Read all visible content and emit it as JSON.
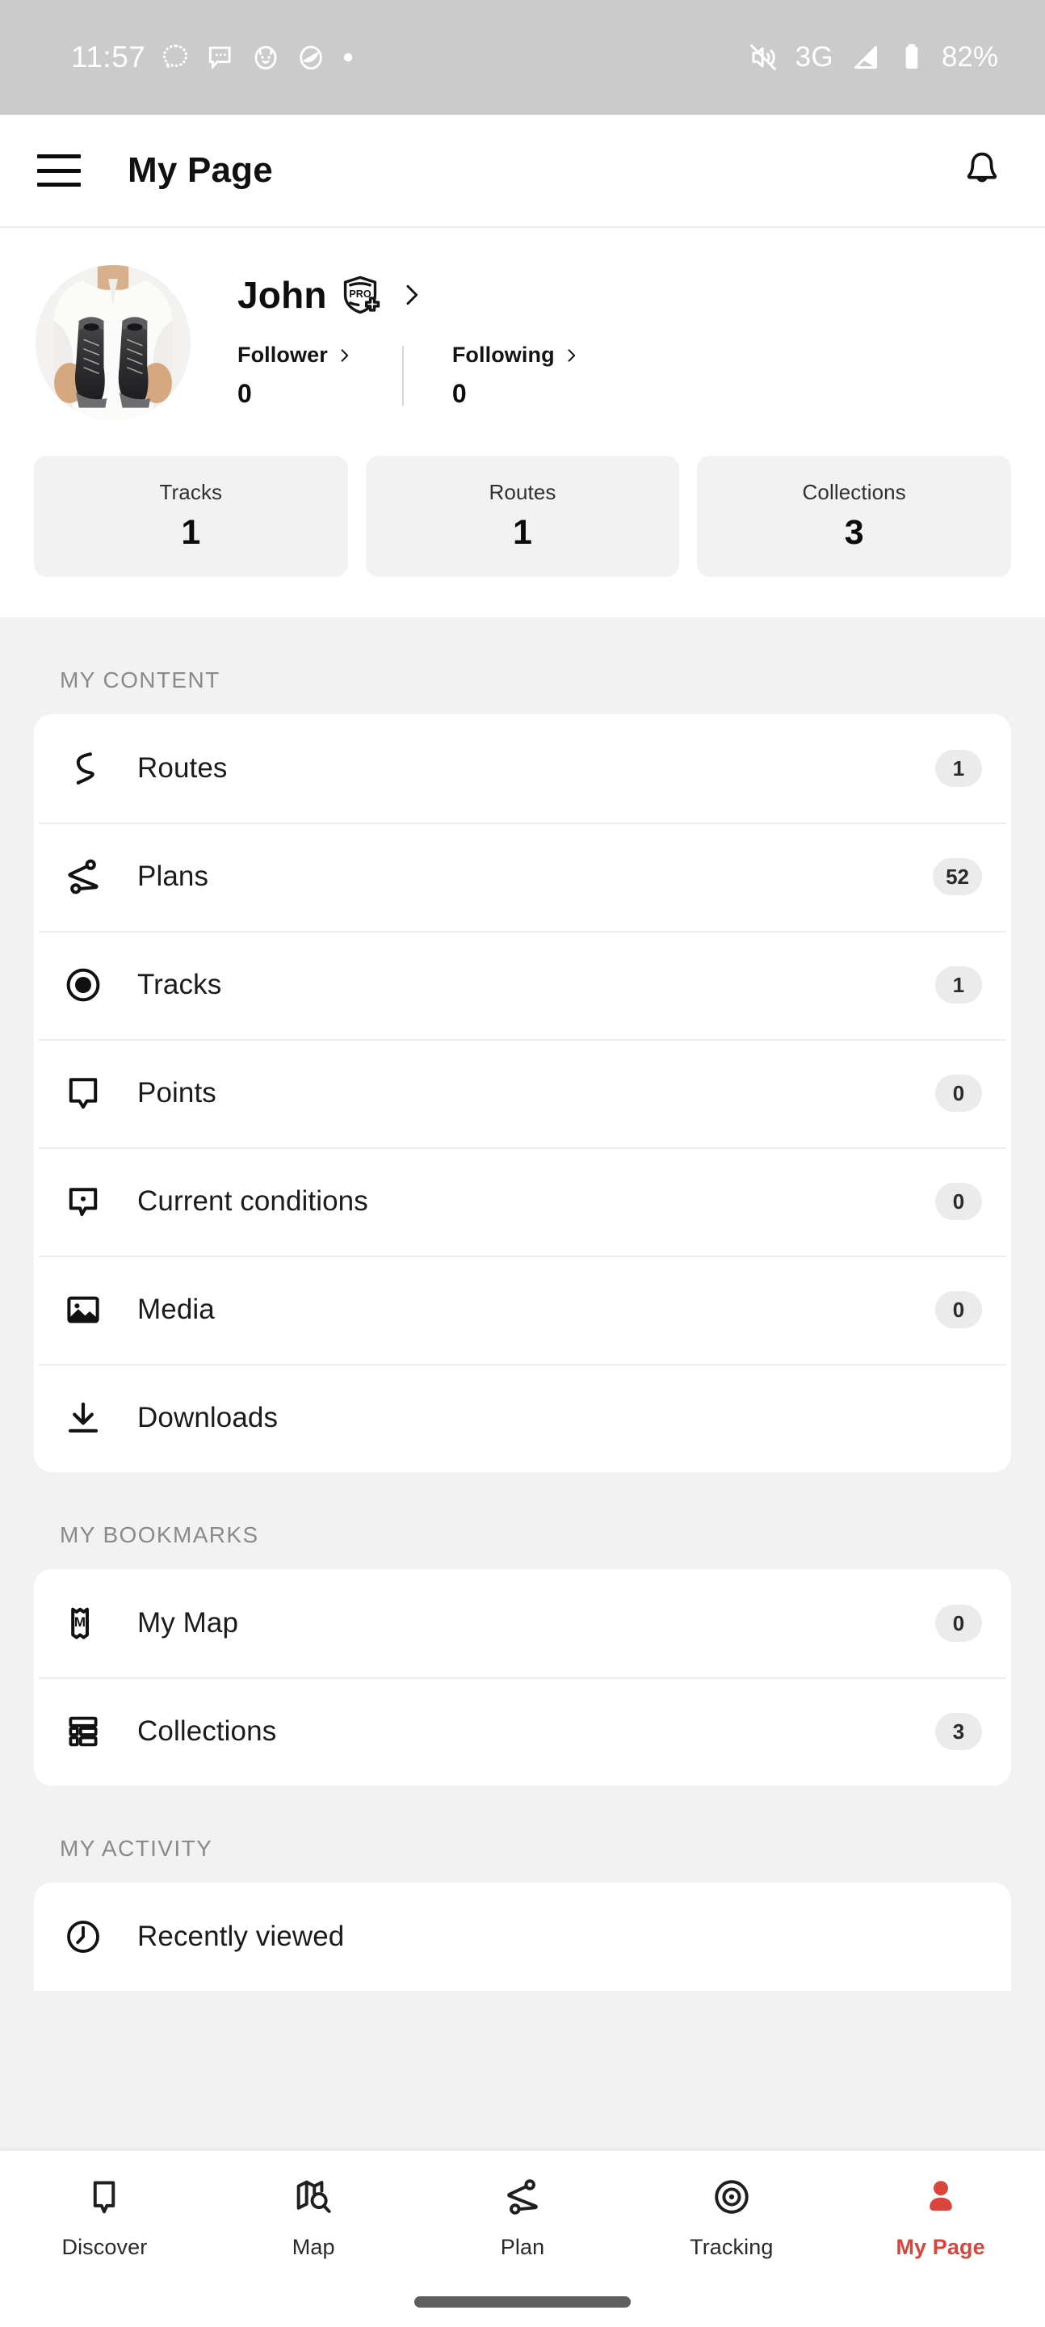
{
  "status_bar": {
    "time": "11:57",
    "left_icons": [
      "signal-messenger-icon",
      "chat-bubble-icon",
      "cat-app-icon",
      "egg-app-icon",
      "dot-icon"
    ],
    "mute_icon": "mute-icon",
    "network": "3G",
    "signal_icon": "signal-strength-icon",
    "battery_icon": "battery-icon",
    "battery": "82%"
  },
  "app_bar": {
    "menu_icon": "hamburger-menu-icon",
    "title": "My Page",
    "notification_icon": "bell-icon"
  },
  "profile": {
    "avatar_alt": "hiking-boots-avatar",
    "name": "John",
    "pro_badge": "pro-plus-badge-icon",
    "chevron": "chevron-right-icon",
    "follower": {
      "label": "Follower",
      "count": "0"
    },
    "following": {
      "label": "Following",
      "count": "0"
    }
  },
  "stats": [
    {
      "label": "Tracks",
      "value": "1"
    },
    {
      "label": "Routes",
      "value": "1"
    },
    {
      "label": "Collections",
      "value": "3"
    }
  ],
  "my_content": {
    "title": "MY CONTENT",
    "items": [
      {
        "label": "Routes",
        "badge": "1",
        "icon": "route-squiggle-icon"
      },
      {
        "label": "Plans",
        "badge": "52",
        "icon": "plan-node-route-icon"
      },
      {
        "label": "Tracks",
        "badge": "1",
        "icon": "record-circle-icon"
      },
      {
        "label": "Points",
        "badge": "0",
        "icon": "map-pin-bubble-icon"
      },
      {
        "label": "Current conditions",
        "badge": "0",
        "icon": "condition-bubble-dot-icon"
      },
      {
        "label": "Media",
        "badge": "0",
        "icon": "image-icon"
      },
      {
        "label": "Downloads",
        "badge": "",
        "icon": "download-icon"
      }
    ]
  },
  "my_bookmarks": {
    "title": "MY BOOKMARKS",
    "items": [
      {
        "label": "My Map",
        "badge": "0",
        "icon": "my-map-icon"
      },
      {
        "label": "Collections",
        "badge": "3",
        "icon": "collections-stack-icon"
      }
    ]
  },
  "my_activity": {
    "title": "MY ACTIVITY",
    "items": [
      {
        "label": "Recently viewed",
        "badge": "",
        "icon": "clock-icon"
      }
    ]
  },
  "bottom_nav": {
    "active_color": "#d9453c",
    "items": [
      {
        "label": "Discover",
        "icon": "discover-bubble-icon",
        "active": false
      },
      {
        "label": "Map",
        "icon": "map-search-icon",
        "active": false
      },
      {
        "label": "Plan",
        "icon": "plan-node-route-icon",
        "active": false
      },
      {
        "label": "Tracking",
        "icon": "tracking-target-icon",
        "active": false
      },
      {
        "label": "My Page",
        "icon": "person-icon",
        "active": true
      }
    ]
  }
}
